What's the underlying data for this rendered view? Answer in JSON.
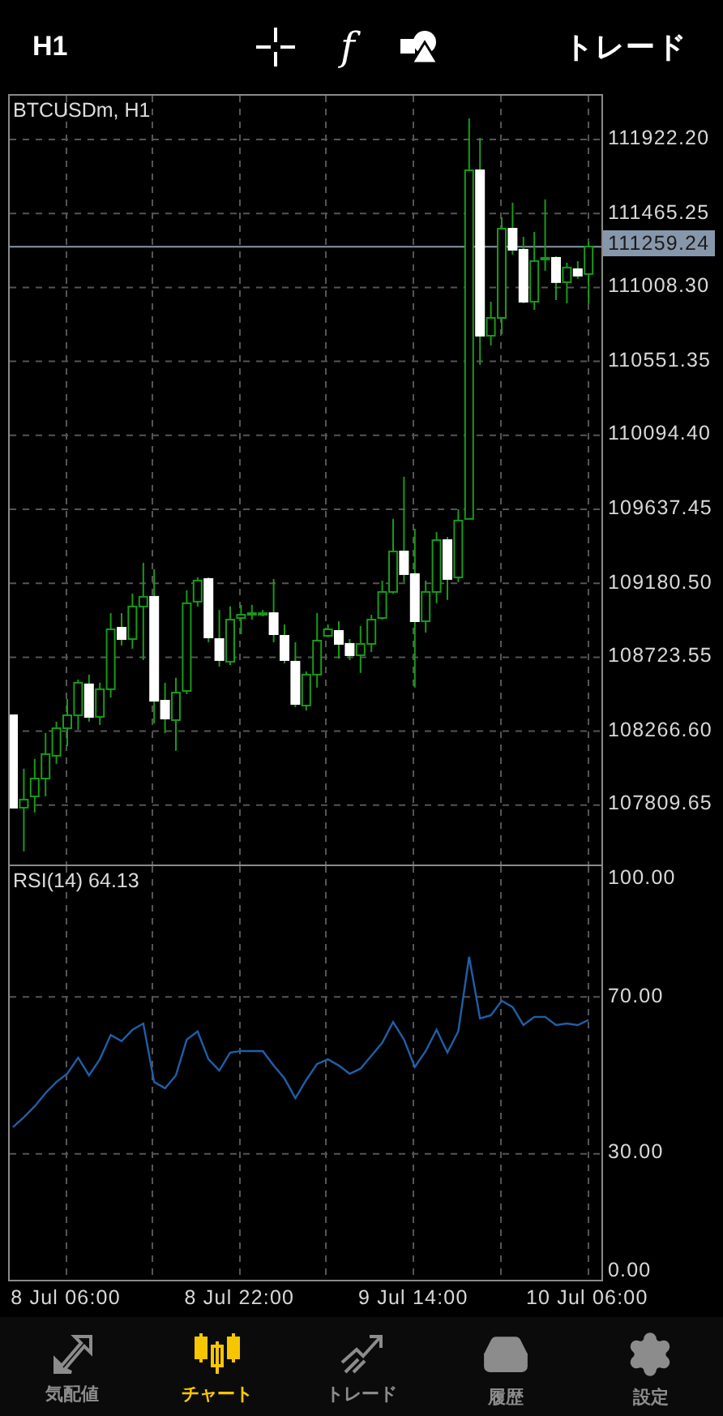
{
  "top_bar": {
    "timeframe": "H1",
    "indicator_symbol": "f",
    "trade_label": "トレード"
  },
  "main_pane": {
    "title": "BTCUSDm, H1",
    "chart_data": {
      "type": "candlestick",
      "grid": true,
      "ylim": [
        107442.9,
        112192.8
      ],
      "ref_lines": [
        {
          "axis": "y",
          "value": 111259.24,
          "label": "111259.24",
          "color": "#8797ab"
        }
      ],
      "ohlc": [
        [
          108365,
          108365,
          107794,
          107794
        ],
        [
          107794,
          108035,
          107524,
          107844
        ],
        [
          107864,
          108095,
          107764,
          107974
        ],
        [
          107974,
          108255,
          107864,
          108125
        ],
        [
          108115,
          108325,
          108065,
          108285
        ],
        [
          108285,
          108465,
          108175,
          108365
        ],
        [
          108365,
          108586,
          108275,
          108566
        ],
        [
          108556,
          108616,
          108325,
          108355
        ],
        [
          108355,
          108566,
          108305,
          108526
        ],
        [
          108526,
          108996,
          108475,
          108896
        ],
        [
          108906,
          108996,
          108796,
          108836
        ],
        [
          108836,
          109117,
          108776,
          109037
        ],
        [
          109037,
          109307,
          108706,
          109097
        ],
        [
          109097,
          109267,
          108315,
          108455
        ],
        [
          108455,
          108566,
          108255,
          108345
        ],
        [
          108335,
          108596,
          108145,
          108505
        ],
        [
          108515,
          109137,
          108495,
          109057
        ],
        [
          109067,
          109217,
          109037,
          109197
        ],
        [
          109207,
          109217,
          108816,
          108846
        ],
        [
          108836,
          109016,
          108666,
          108706
        ],
        [
          108696,
          109037,
          108676,
          108956
        ],
        [
          108966,
          109047,
          108866,
          108986
        ],
        [
          108986,
          109047,
          108956,
          108996
        ],
        [
          108986,
          109016,
          108976,
          108996
        ],
        [
          108996,
          109207,
          108816,
          108866
        ],
        [
          108856,
          108926,
          108686,
          108706
        ],
        [
          108696,
          108816,
          108415,
          108435
        ],
        [
          108425,
          108636,
          108395,
          108616
        ],
        [
          108616,
          108996,
          108536,
          108826
        ],
        [
          108856,
          108926,
          108846,
          108896
        ],
        [
          108886,
          108946,
          108716,
          108806
        ],
        [
          108806,
          108836,
          108706,
          108736
        ],
        [
          108736,
          108916,
          108626,
          108806
        ],
        [
          108806,
          108986,
          108756,
          108956
        ],
        [
          108966,
          109197,
          108956,
          109127
        ],
        [
          109127,
          109578,
          109117,
          109377
        ],
        [
          109377,
          109838,
          109187,
          109237
        ],
        [
          109237,
          109517,
          108536,
          108946
        ],
        [
          108946,
          109197,
          108876,
          109127
        ],
        [
          109127,
          109497,
          109057,
          109447
        ],
        [
          109447,
          109467,
          109077,
          109207
        ],
        [
          109217,
          109638,
          109187,
          109568
        ],
        [
          109578,
          112053,
          109578,
          111732
        ],
        [
          111732,
          111932,
          110530,
          110710
        ],
        [
          110710,
          110920,
          110650,
          110820
        ],
        [
          110820,
          111441,
          110720,
          111371
        ],
        [
          111371,
          111532,
          111211,
          111241
        ],
        [
          111241,
          111321,
          110910,
          110920
        ],
        [
          110920,
          111351,
          110870,
          111171
        ],
        [
          111181,
          111552,
          111111,
          111191
        ],
        [
          111191,
          111201,
          110930,
          111041
        ],
        [
          111041,
          111161,
          110910,
          111131
        ],
        [
          111121,
          111171,
          111061,
          111081
        ],
        [
          111091,
          111291,
          110910,
          111261
        ]
      ],
      "yticks": [
        {
          "value": 111922.2,
          "label": "111922.20"
        },
        {
          "value": 111465.25,
          "label": "111465.25"
        },
        {
          "value": 111008.3,
          "label": "111008.30"
        },
        {
          "value": 110551.35,
          "label": "110551.35"
        },
        {
          "value": 110094.4,
          "label": "110094.40"
        },
        {
          "value": 109637.45,
          "label": "109637.45"
        },
        {
          "value": 109180.5,
          "label": "109180.50"
        },
        {
          "value": 108723.55,
          "label": "108723.55"
        },
        {
          "value": 108266.6,
          "label": "108266.60"
        },
        {
          "value": 107809.65,
          "label": "107809.65"
        }
      ]
    }
  },
  "rsi_pane": {
    "title": "RSI(14) 64.13",
    "chart_data": {
      "type": "line",
      "grid": true,
      "categories": [
        null,
        null,
        null,
        null,
        null,
        "8 Jul 06:00",
        null,
        null,
        null,
        null,
        null,
        null,
        null,
        null,
        null,
        null,
        null,
        null,
        null,
        null,
        null,
        "8 Jul 22:00",
        null,
        null,
        null,
        null,
        null,
        null,
        null,
        null,
        null,
        null,
        null,
        null,
        null,
        null,
        null,
        "9 Jul 14:00",
        null,
        null,
        null,
        null,
        null,
        null,
        null,
        null,
        null,
        null,
        null,
        null,
        null,
        null,
        null,
        "10 Jul 06:00"
      ],
      "ylim": [
        -2.5,
        103.3
      ],
      "yticks": [
        {
          "value": 100,
          "label": "100.00"
        },
        {
          "value": 70,
          "label": "70.00"
        },
        {
          "value": 30,
          "label": "30.00"
        },
        {
          "value": 0,
          "label": "0.00"
        }
      ],
      "series": [
        {
          "color": "#1f5fa8",
          "values": [
            36.8,
            39.3,
            42.1,
            45.5,
            48.3,
            50.4,
            54.5,
            50.0,
            54.1,
            60.3,
            58.7,
            61.6,
            63.2,
            48.3,
            46.7,
            50.0,
            59.1,
            61.2,
            54.1,
            51.2,
            55.8,
            56.2,
            56.2,
            56.2,
            52.5,
            49.2,
            44.2,
            48.8,
            52.9,
            54.1,
            52.5,
            50.4,
            51.7,
            55.0,
            58.3,
            63.6,
            59.1,
            52.1,
            56.2,
            61.6,
            55.8,
            61.2,
            80.2,
            64.5,
            65.3,
            69.0,
            67.4,
            62.8,
            64.9,
            64.9,
            62.8,
            63.2,
            62.8,
            64.1
          ]
        }
      ]
    }
  },
  "tab_bar": [
    {
      "label": "気配値",
      "kind": "quotes",
      "selected": false
    },
    {
      "label": "チャート",
      "kind": "chart",
      "selected": true
    },
    {
      "label": "トレード",
      "kind": "trade",
      "selected": false
    },
    {
      "label": "履歴",
      "kind": "history",
      "selected": false
    },
    {
      "label": "設定",
      "kind": "settings",
      "selected": false
    }
  ]
}
